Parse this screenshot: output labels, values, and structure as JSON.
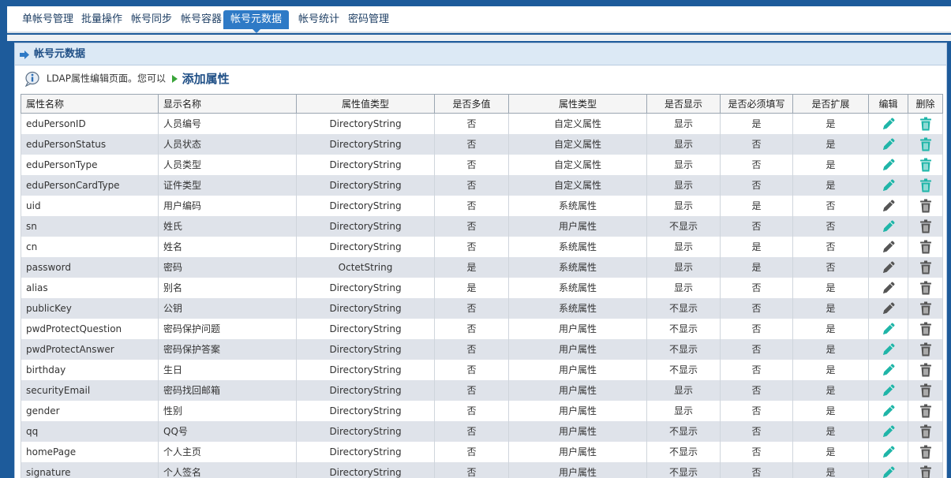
{
  "tabs": [
    {
      "label": "单帐号管理",
      "active": false
    },
    {
      "label": "批量操作",
      "active": false
    },
    {
      "label": "帐号同步",
      "active": false
    },
    {
      "label": "帐号容器",
      "active": false
    },
    {
      "label": "帐号元数据",
      "active": true
    },
    {
      "label": "帐号统计",
      "active": false
    },
    {
      "label": "密码管理",
      "active": false
    }
  ],
  "panel": {
    "title": "帐号元数据",
    "info_text": "LDAP属性编辑页面。您可以",
    "add_link": "添加属性"
  },
  "colors": {
    "brand": "#1d5b9b",
    "active_tab": "#2e7ac6",
    "edit_enabled": "#1fb5a8",
    "edit_disabled": "#555555",
    "delete_enabled": "#1fb5a8",
    "delete_disabled": "#555555"
  },
  "table": {
    "headers": [
      "属性名称",
      "显示名称",
      "属性值类型",
      "是否多值",
      "属性类型",
      "是否显示",
      "是否必须填写",
      "是否扩展",
      "编辑",
      "删除"
    ],
    "rows": [
      {
        "name": "eduPersonID",
        "display": "人员编号",
        "value_type": "DirectoryString",
        "multi": "否",
        "attr_type": "自定义属性",
        "show": "显示",
        "required": "是",
        "ext": "是",
        "edit_icon": "pencil-icon",
        "edit_enabled": true,
        "delete_icon": "trash-icon",
        "delete_enabled": true
      },
      {
        "name": "eduPersonStatus",
        "display": "人员状态",
        "value_type": "DirectoryString",
        "multi": "否",
        "attr_type": "自定义属性",
        "show": "显示",
        "required": "否",
        "ext": "是",
        "edit_icon": "pencil-icon",
        "edit_enabled": true,
        "delete_icon": "trash-icon",
        "delete_enabled": true
      },
      {
        "name": "eduPersonType",
        "display": "人员类型",
        "value_type": "DirectoryString",
        "multi": "否",
        "attr_type": "自定义属性",
        "show": "显示",
        "required": "否",
        "ext": "是",
        "edit_icon": "pencil-icon",
        "edit_enabled": true,
        "delete_icon": "trash-icon",
        "delete_enabled": true
      },
      {
        "name": "eduPersonCardType",
        "display": "证件类型",
        "value_type": "DirectoryString",
        "multi": "否",
        "attr_type": "自定义属性",
        "show": "显示",
        "required": "否",
        "ext": "是",
        "edit_icon": "pencil-icon",
        "edit_enabled": true,
        "delete_icon": "trash-icon",
        "delete_enabled": true
      },
      {
        "name": "uid",
        "display": "用户编码",
        "value_type": "DirectoryString",
        "multi": "否",
        "attr_type": "系统属性",
        "show": "显示",
        "required": "是",
        "ext": "否",
        "edit_icon": "pencil-icon",
        "edit_enabled": false,
        "delete_icon": "trash-icon",
        "delete_enabled": false
      },
      {
        "name": "sn",
        "display": "姓氏",
        "value_type": "DirectoryString",
        "multi": "否",
        "attr_type": "用户属性",
        "show": "不显示",
        "required": "否",
        "ext": "否",
        "edit_icon": "pencil-icon",
        "edit_enabled": true,
        "delete_icon": "trash-icon",
        "delete_enabled": false
      },
      {
        "name": "cn",
        "display": "姓名",
        "value_type": "DirectoryString",
        "multi": "否",
        "attr_type": "系统属性",
        "show": "显示",
        "required": "是",
        "ext": "否",
        "edit_icon": "pencil-icon",
        "edit_enabled": false,
        "delete_icon": "trash-icon",
        "delete_enabled": false
      },
      {
        "name": "password",
        "display": "密码",
        "value_type": "OctetString",
        "multi": "是",
        "attr_type": "系统属性",
        "show": "显示",
        "required": "是",
        "ext": "否",
        "edit_icon": "pencil-icon",
        "edit_enabled": false,
        "delete_icon": "trash-icon",
        "delete_enabled": false
      },
      {
        "name": "alias",
        "display": "别名",
        "value_type": "DirectoryString",
        "multi": "是",
        "attr_type": "系统属性",
        "show": "显示",
        "required": "否",
        "ext": "是",
        "edit_icon": "pencil-icon",
        "edit_enabled": false,
        "delete_icon": "trash-icon",
        "delete_enabled": false
      },
      {
        "name": "publicKey",
        "display": "公钥",
        "value_type": "DirectoryString",
        "multi": "否",
        "attr_type": "系统属性",
        "show": "不显示",
        "required": "否",
        "ext": "是",
        "edit_icon": "pencil-icon",
        "edit_enabled": false,
        "delete_icon": "trash-icon",
        "delete_enabled": false
      },
      {
        "name": "pwdProtectQuestion",
        "display": "密码保护问题",
        "value_type": "DirectoryString",
        "multi": "否",
        "attr_type": "用户属性",
        "show": "不显示",
        "required": "否",
        "ext": "是",
        "edit_icon": "pencil-icon",
        "edit_enabled": true,
        "delete_icon": "trash-icon",
        "delete_enabled": false
      },
      {
        "name": "pwdProtectAnswer",
        "display": "密码保护答案",
        "value_type": "DirectoryString",
        "multi": "否",
        "attr_type": "用户属性",
        "show": "不显示",
        "required": "否",
        "ext": "是",
        "edit_icon": "pencil-icon",
        "edit_enabled": true,
        "delete_icon": "trash-icon",
        "delete_enabled": false
      },
      {
        "name": "birthday",
        "display": "生日",
        "value_type": "DirectoryString",
        "multi": "否",
        "attr_type": "用户属性",
        "show": "不显示",
        "required": "否",
        "ext": "是",
        "edit_icon": "pencil-icon",
        "edit_enabled": true,
        "delete_icon": "trash-icon",
        "delete_enabled": false
      },
      {
        "name": "securityEmail",
        "display": "密码找回邮箱",
        "value_type": "DirectoryString",
        "multi": "否",
        "attr_type": "用户属性",
        "show": "显示",
        "required": "否",
        "ext": "是",
        "edit_icon": "pencil-icon",
        "edit_enabled": true,
        "delete_icon": "trash-icon",
        "delete_enabled": false
      },
      {
        "name": "gender",
        "display": "性别",
        "value_type": "DirectoryString",
        "multi": "否",
        "attr_type": "用户属性",
        "show": "显示",
        "required": "否",
        "ext": "是",
        "edit_icon": "pencil-icon",
        "edit_enabled": true,
        "delete_icon": "trash-icon",
        "delete_enabled": false
      },
      {
        "name": "qq",
        "display": "QQ号",
        "value_type": "DirectoryString",
        "multi": "否",
        "attr_type": "用户属性",
        "show": "不显示",
        "required": "否",
        "ext": "是",
        "edit_icon": "pencil-icon",
        "edit_enabled": true,
        "delete_icon": "trash-icon",
        "delete_enabled": false
      },
      {
        "name": "homePage",
        "display": "个人主页",
        "value_type": "DirectoryString",
        "multi": "否",
        "attr_type": "用户属性",
        "show": "不显示",
        "required": "否",
        "ext": "是",
        "edit_icon": "pencil-icon",
        "edit_enabled": true,
        "delete_icon": "trash-icon",
        "delete_enabled": false
      },
      {
        "name": "signature",
        "display": "个人签名",
        "value_type": "DirectoryString",
        "multi": "否",
        "attr_type": "用户属性",
        "show": "不显示",
        "required": "否",
        "ext": "是",
        "edit_icon": "pencil-icon",
        "edit_enabled": true,
        "delete_icon": "trash-icon",
        "delete_enabled": false
      }
    ]
  }
}
